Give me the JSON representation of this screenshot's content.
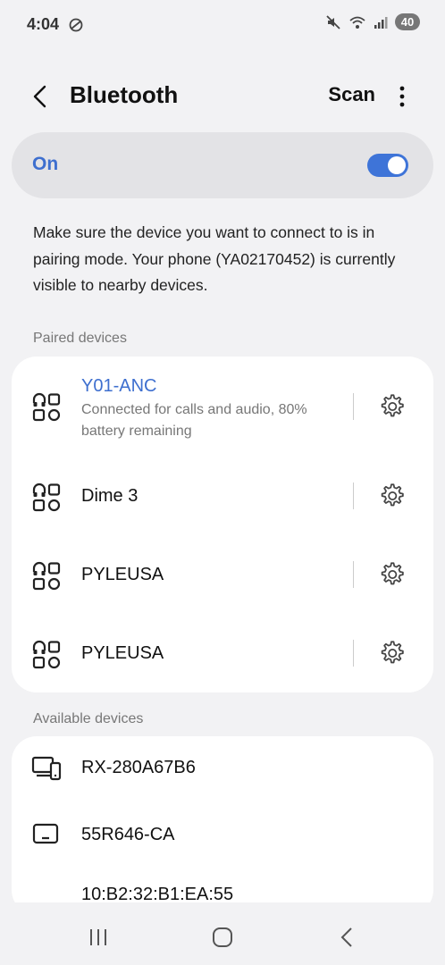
{
  "status_bar": {
    "time": "4:04",
    "battery_level": "40"
  },
  "header": {
    "title": "Bluetooth",
    "scan_label": "Scan"
  },
  "bluetooth_toggle": {
    "label": "On",
    "state": true,
    "accent_color": "#3e74d8"
  },
  "description": "Make sure the device you want to connect to is in pairing mode. Your phone (YA02170452) is currently visible to nearby devices.",
  "paired_devices": {
    "header": "Paired devices",
    "items": [
      {
        "name": "Y01-ANC",
        "status": "Connected for calls and audio, 80% battery remaining",
        "icon": "headset-icon",
        "connected": true
      },
      {
        "name": "Dime 3",
        "status": "",
        "icon": "headset-icon",
        "connected": false
      },
      {
        "name": "PYLEUSA",
        "status": "",
        "icon": "headset-icon",
        "connected": false
      },
      {
        "name": "PYLEUSA",
        "status": "",
        "icon": "headset-icon",
        "connected": false
      }
    ]
  },
  "available_devices": {
    "header": "Available devices",
    "items": [
      {
        "name": "RX-280A67B6",
        "icon": "devices-icon"
      },
      {
        "name": "55R646-CA",
        "icon": "tv-icon"
      },
      {
        "name": "10:B2:32:B1:EA:55",
        "icon": "tv-icon"
      }
    ]
  }
}
